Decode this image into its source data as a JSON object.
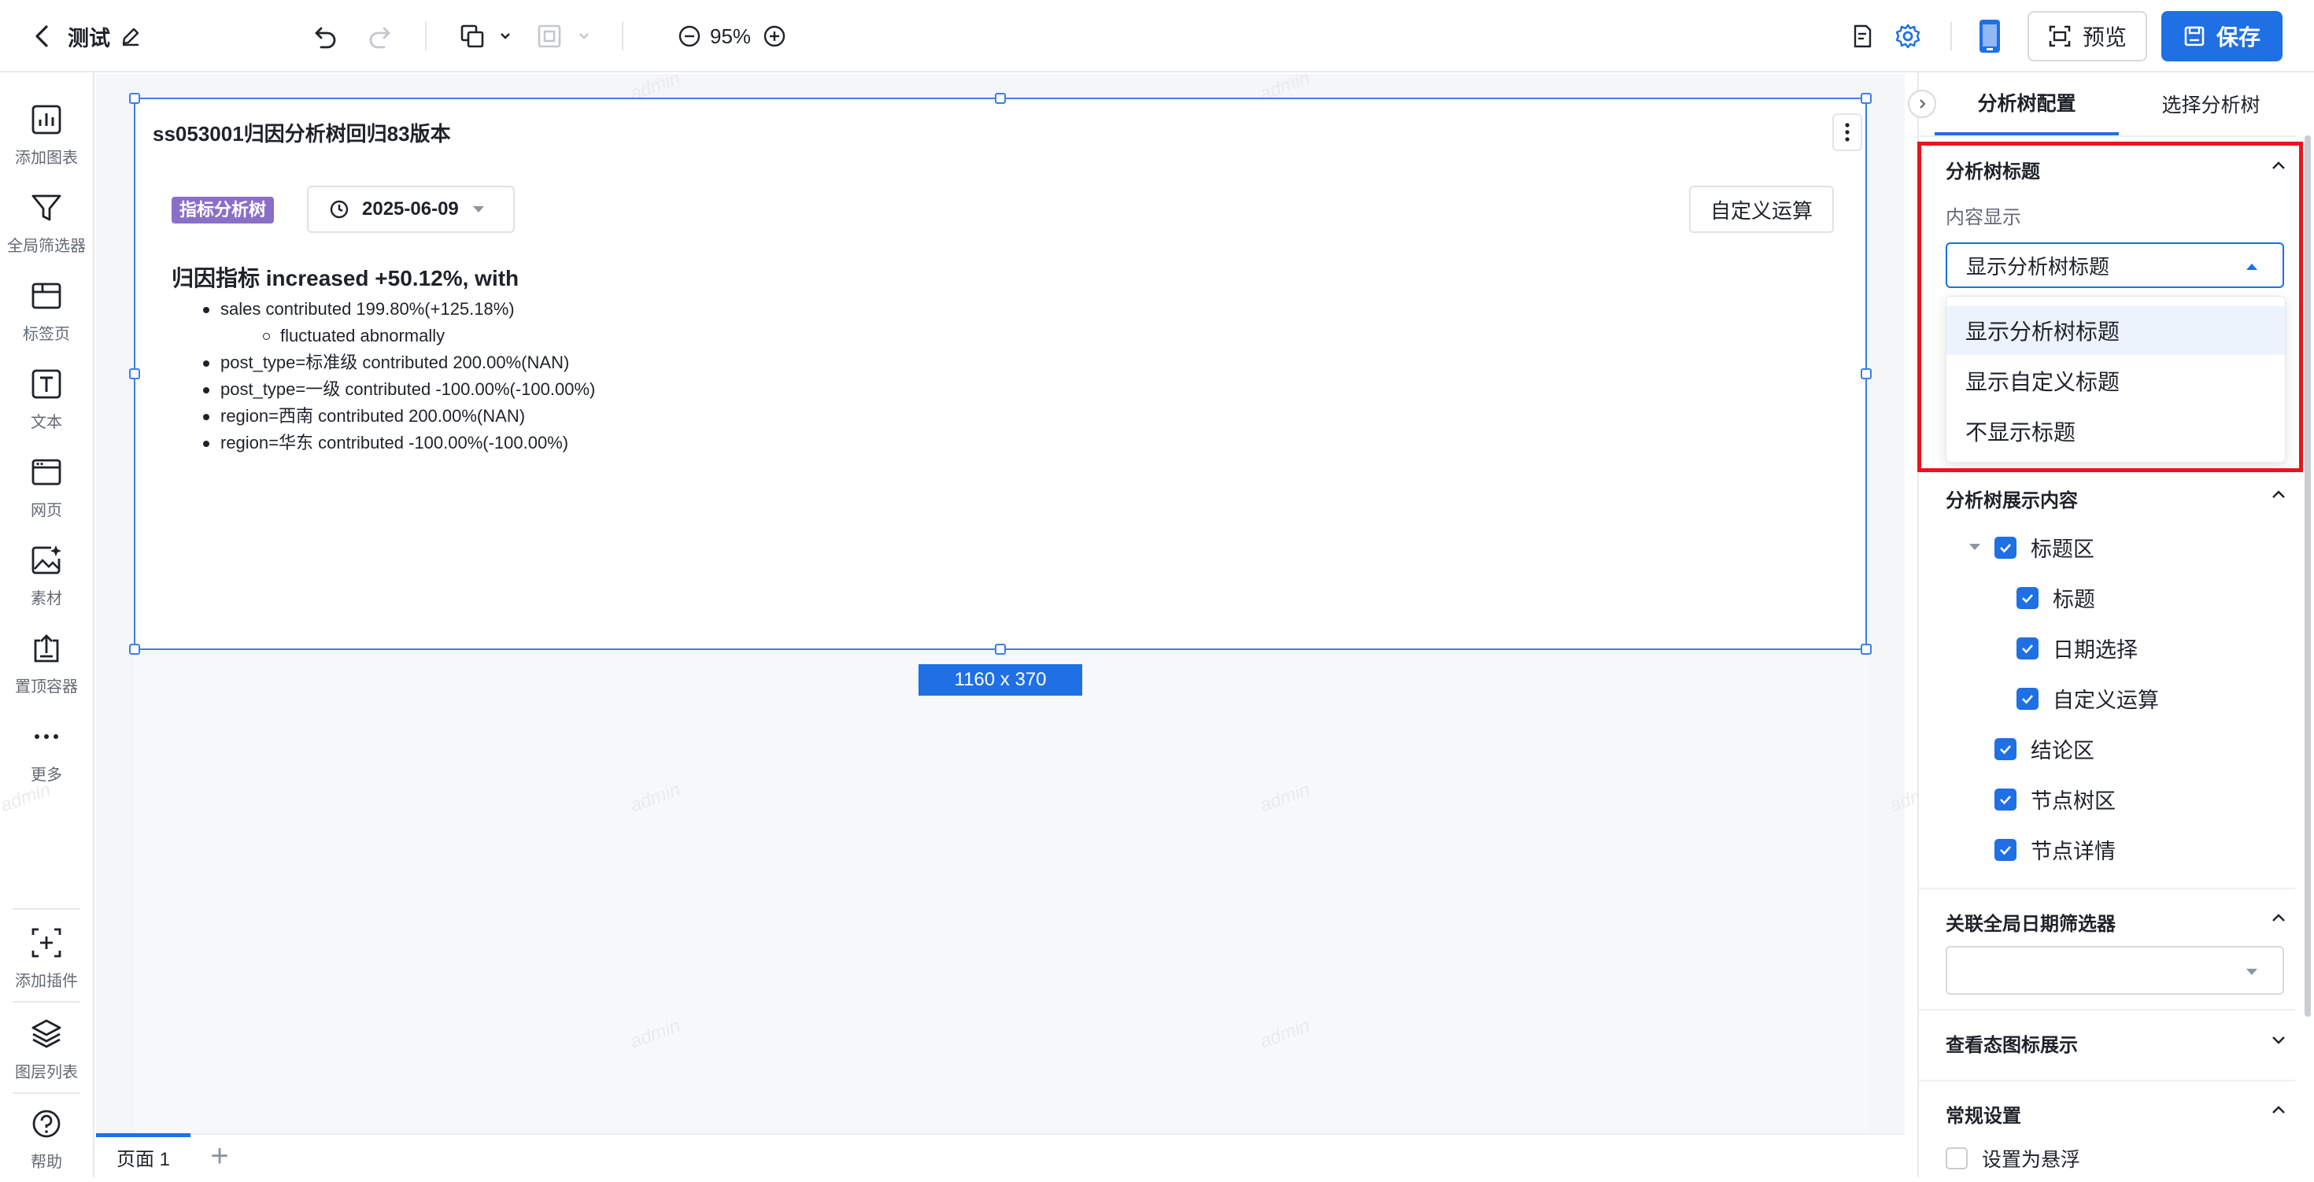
{
  "topbar": {
    "title": "测试",
    "zoom": "95%",
    "preview_label": "预览",
    "save_label": "保存"
  },
  "leftbar": {
    "items": [
      {
        "label": "添加图表",
        "icon": "bar-chart-icon"
      },
      {
        "label": "全局筛选器",
        "icon": "filter-icon"
      },
      {
        "label": "标签页",
        "icon": "tabs-icon"
      },
      {
        "label": "文本",
        "icon": "text-icon"
      },
      {
        "label": "网页",
        "icon": "webpage-icon"
      },
      {
        "label": "素材",
        "icon": "asset-image-icon"
      },
      {
        "label": "置顶容器",
        "icon": "pin-top-icon"
      },
      {
        "label": "更多",
        "icon": "more-dots-icon"
      }
    ],
    "bottom_items": [
      {
        "label": "添加插件",
        "icon": "add-plugin-icon"
      },
      {
        "label": "图层列表",
        "icon": "layers-icon"
      },
      {
        "label": "帮助",
        "icon": "help-icon"
      }
    ]
  },
  "widget": {
    "title": "ss053001归因分析树回归83版本",
    "tag": "指标分析树",
    "date": "2025-06-09",
    "custom_op_label": "自定义运算",
    "summary": "归因指标 increased +50.12%, with",
    "bullets": [
      "sales contributed 199.80%(+125.18%)",
      "fluctuated abnormally",
      "post_type=标准级 contributed 200.00%(NAN)",
      "post_type=一级 contributed -100.00%(-100.00%)",
      "region=西南 contributed 200.00%(NAN)",
      "region=华东 contributed -100.00%(-100.00%)"
    ],
    "size_label": "1160 x 370"
  },
  "watermark": "admin",
  "pagetabs": {
    "page1": "页面 1",
    "add": "+"
  },
  "rightpanel": {
    "tabs": [
      "分析树配置",
      "选择分析树"
    ],
    "title_section": {
      "title": "分析树标题",
      "content_label": "内容显示",
      "selected": "显示分析树标题",
      "options": [
        "显示分析树标题",
        "显示自定义标题",
        "不显示标题"
      ]
    },
    "display_section": {
      "title": "分析树展示内容",
      "items": [
        "标题区",
        "标题",
        "日期选择",
        "自定义运算",
        "结论区",
        "节点树区",
        "节点详情"
      ]
    },
    "date_filter_section": {
      "title": "关联全局日期筛选器"
    },
    "icon_section": {
      "title": "查看态图标展示"
    },
    "general_section": {
      "title": "常规设置",
      "float_label": "设置为悬浮"
    }
  },
  "colors": {
    "primary": "#1f6fe5",
    "tag_purple": "#8a6fc9",
    "highlight_red": "#e8141d"
  }
}
